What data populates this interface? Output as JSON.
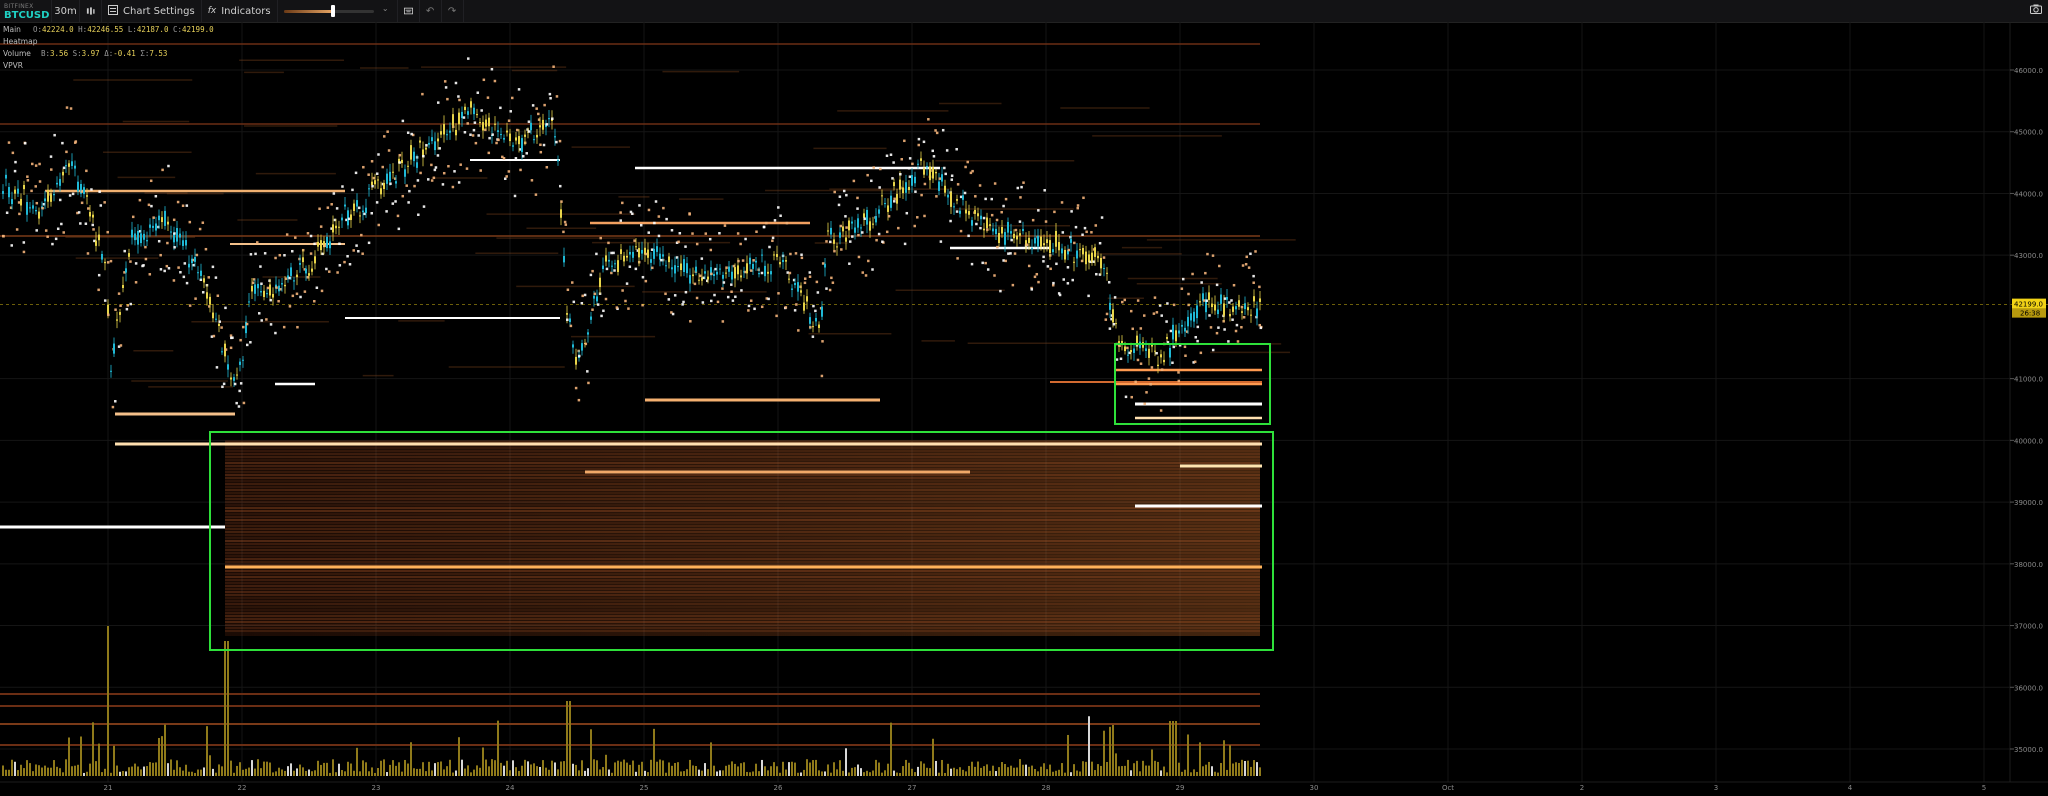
{
  "toolbar": {
    "exchange": "BITFINEX",
    "symbol": "BTCUSD",
    "interval": "30m",
    "chart_settings_label": "Chart Settings",
    "indicators_label": "Indicators",
    "icons": [
      "bar-type-icon",
      "settings-icon",
      "fx-icon",
      "slider-chevron-icon",
      "keyboard-icon",
      "undo-icon",
      "redo-icon",
      "camera-icon"
    ],
    "heatmap_intensity": 0.55
  },
  "legend": {
    "main_label": "Main",
    "heatmap_label": "Heatmap",
    "volume_label": "Volume",
    "vpvr_label": "VPVR",
    "ohlc": {
      "o_key": "O:",
      "o": "42224.0",
      "h_key": "H:",
      "h": "42246.55",
      "l_key": "L:",
      "l": "42187.0",
      "c_key": "C:",
      "c": "42199.0"
    },
    "volume": {
      "b_key": "B:",
      "b": "3.56",
      "s_key": "S:",
      "s": "3.97",
      "d_key": "Δ:",
      "d": "-0.41",
      "t_key": "Σ:",
      "t": "7.53"
    }
  },
  "price_axis": {
    "ticks": [
      "46000.0",
      "45000.0",
      "44000.0",
      "43000.0",
      "41000.0",
      "40000.0",
      "39000.0",
      "38000.0",
      "37000.0",
      "36000.0",
      "35000.0"
    ],
    "current_price": "42199.0",
    "countdown": "26:38"
  },
  "time_axis": {
    "ticks": [
      "21",
      "22",
      "23",
      "24",
      "25",
      "26",
      "27",
      "28",
      "29",
      "30",
      "Oct",
      "2",
      "3",
      "4",
      "5"
    ]
  },
  "colors": {
    "up_candle": "#1fb9d6",
    "down_candle": "#e8d54a",
    "highlight_box": "#2ee03a",
    "price_tag": "#f2d316",
    "volume_bar": "#8f7a1a"
  }
}
